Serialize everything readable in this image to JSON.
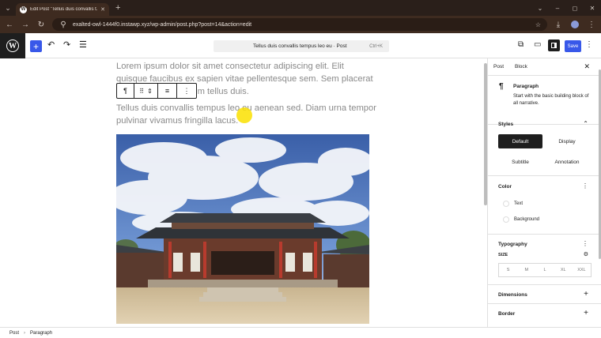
{
  "browser": {
    "tab_title": "Edit Post \"Tellus duis convallis t...",
    "tab_close": "✕",
    "new_tab": "+",
    "url": "exalted-owl-1444f0.instawp.xyz/wp-admin/post.php?post=14&action=edit",
    "window_controls": [
      "⌄",
      "–",
      "◻",
      "✕"
    ]
  },
  "editor_header": {
    "logo": "W",
    "add_block_label": "+",
    "document_title": "Tellus duis convallis tempus leo eu · Post",
    "shortcut": "Ctrl+K",
    "save_label": "Save",
    "undo_icon": "undo-icon",
    "redo_icon": "redo-icon",
    "list_view_icon": "list-view-icon"
  },
  "content": {
    "paragraph1": "Lorem ipsum dolor sit amet consectetur adipiscing elit. Elit quisque faucibus ex sapien vitae pellentesque sem. Sem placerat in id cursus mi pretium tellus duis.",
    "paragraph2": "Tellus duis convallis tempus leo eu aenean sed. Diam urna tempor pulvinar vivamus fringilla lacus."
  },
  "block_toolbar": {
    "icons": [
      "paragraph-icon",
      "drag-icon",
      "move-icon",
      "align-icon",
      "more-options-icon"
    ],
    "glyphs": [
      "¶",
      "⠿",
      "⌃",
      "≡",
      "⋮"
    ]
  },
  "sidebar": {
    "tabs": [
      "Post",
      "Block"
    ],
    "close": "✕",
    "block_name": "Paragraph",
    "block_description": "Start with the basic building block of all narrative.",
    "styles": {
      "title": "Styles",
      "options": [
        "Default",
        "Display",
        "Subtitle",
        "Annotation"
      ],
      "selected": "Default"
    },
    "color": {
      "title": "Color",
      "items": [
        "Text",
        "Background"
      ]
    },
    "typography": {
      "title": "Typography",
      "size_label": "SIZE",
      "sizes": [
        "S",
        "M",
        "L",
        "XL",
        "XXL"
      ]
    },
    "dimensions_title": "Dimensions",
    "border_title": "Border"
  },
  "footer": {
    "breadcrumbs": [
      "Post",
      "Paragraph"
    ]
  },
  "colors": {
    "accent": "#3858e9",
    "chrome_dark": "#2a1f1a",
    "chrome": "#3e2b20",
    "cursor_highlight": "#fae100"
  }
}
